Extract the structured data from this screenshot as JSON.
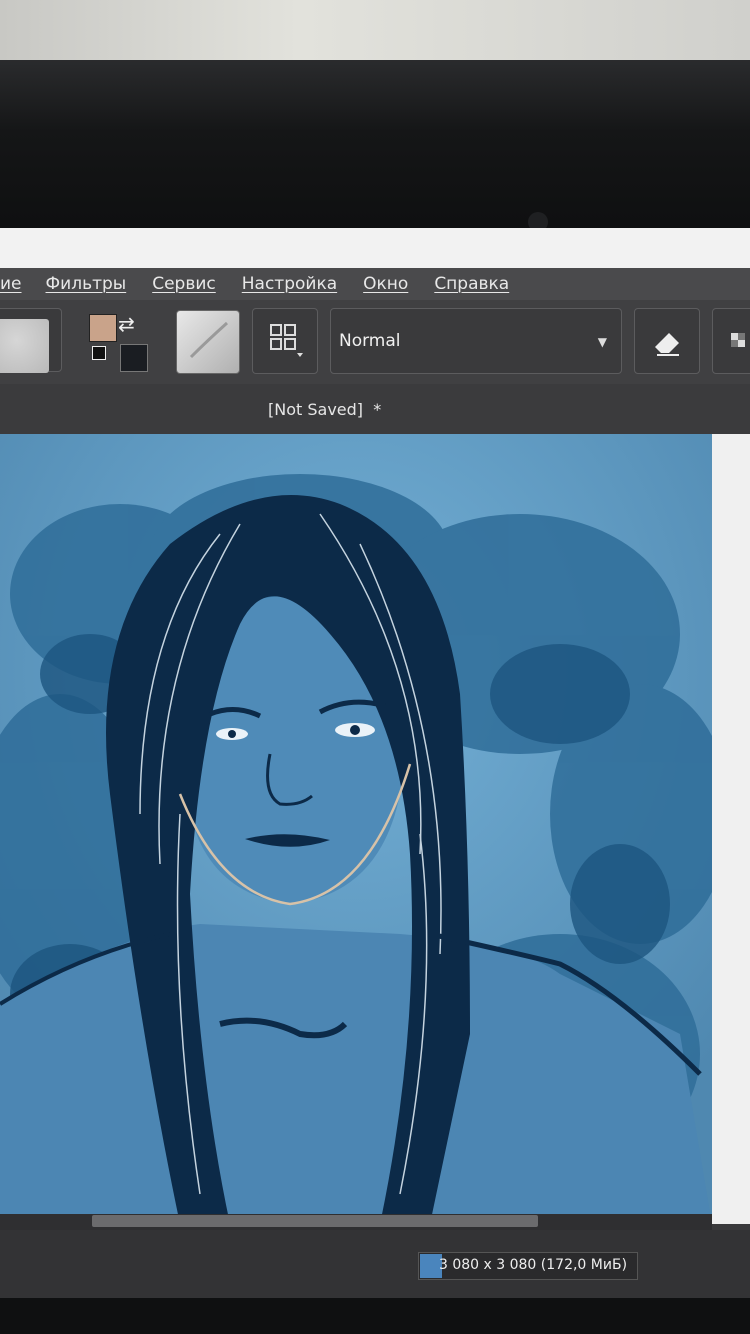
{
  "menubar": {
    "items": [
      "ие",
      "Фильтры",
      "Сервис",
      "Настройка",
      "Окно",
      "Справка"
    ]
  },
  "toolbar": {
    "blend_mode": "Normal",
    "fg_color": "#c9a38a",
    "bg_color": "#1a1d22",
    "icons": [
      "brush-preset-icon",
      "swap-colors-icon",
      "reset-colors-icon",
      "brush-tip-icon",
      "grid-icon",
      "dropdown-caret-icon",
      "eraser-icon",
      "alpha-lock-icon"
    ]
  },
  "document": {
    "title": "[Not Saved]",
    "modified_marker": "*"
  },
  "status": {
    "image_size": "3 080 x 3 080 (172,0 МиБ)",
    "progress": 0.1
  },
  "colors": {
    "canvas_sky": "#5f9ac0",
    "ink": "#0c2a48",
    "menubar": "#4a4a4c",
    "toolbar": "#404042"
  }
}
